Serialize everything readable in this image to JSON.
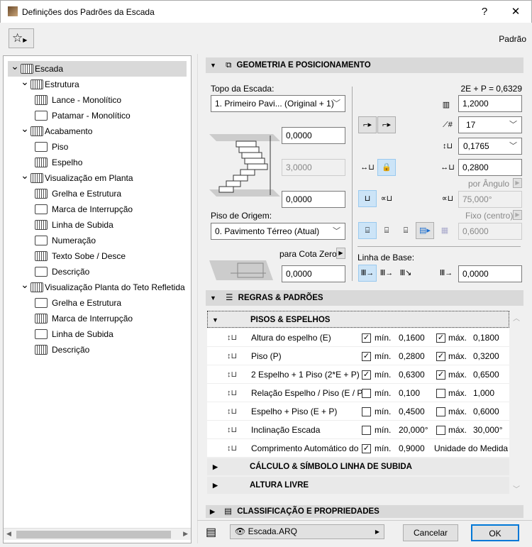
{
  "window": {
    "title": "Definições dos Padrões da Escada",
    "help": "?",
    "close": "✕"
  },
  "toolbar": {
    "favorites_icon": "star-icon",
    "preset": "Padrão"
  },
  "tree": [
    {
      "label": "Escada",
      "level": 0,
      "icon": "stair-icon",
      "expanded": true,
      "selected": true
    },
    {
      "label": "Estrutura",
      "level": 1,
      "icon": "structure-icon",
      "expanded": true
    },
    {
      "label": "Lance - Monolítico",
      "level": 2,
      "icon": "flight-icon"
    },
    {
      "label": "Patamar - Monolítico",
      "level": 2,
      "icon": "landing-icon"
    },
    {
      "label": "Acabamento",
      "level": 1,
      "icon": "finish-icon",
      "expanded": true
    },
    {
      "label": "Piso",
      "level": 2,
      "icon": "tread-icon"
    },
    {
      "label": "Espelho",
      "level": 2,
      "icon": "riser-icon"
    },
    {
      "label": "Visualização em Planta",
      "level": 1,
      "icon": "floor-plan-icon",
      "expanded": true
    },
    {
      "label": "Grelha e Estrutura",
      "level": 2,
      "icon": "grid-icon"
    },
    {
      "label": "Marca de Interrupção",
      "level": 2,
      "icon": "break-mark-icon"
    },
    {
      "label": "Linha de Subida",
      "level": 2,
      "icon": "walking-line-icon"
    },
    {
      "label": "Numeração",
      "level": 2,
      "icon": "numbering-icon"
    },
    {
      "label": "Texto Sobe / Desce",
      "level": 2,
      "icon": "text-icon"
    },
    {
      "label": "Descrição",
      "level": 2,
      "icon": "text-icon"
    },
    {
      "label": "Visualização Planta do Teto Refletida",
      "level": 1,
      "icon": "rcp-icon",
      "expanded": true
    },
    {
      "label": "Grelha e Estrutura",
      "level": 2,
      "icon": "grid-icon"
    },
    {
      "label": "Marca de Interrupção",
      "level": 2,
      "icon": "break-mark-icon"
    },
    {
      "label": "Linha de Subida",
      "level": 2,
      "icon": "walking-line-icon"
    },
    {
      "label": "Descrição",
      "level": 2,
      "icon": "text-icon"
    }
  ],
  "geometry": {
    "header": "GEOMETRIA E POSICIONAMENTO",
    "top_label": "Topo da Escada:",
    "top_value": "1. Primeiro Pavi... (Original + 1)",
    "top_offset": "0,0000",
    "height": "3,0000",
    "bottom_offset": "0,0000",
    "origin_label": "Piso de Origem:",
    "origin_value": "0. Pavimento Térreo (Atual)",
    "zero_label": "para Cota Zero",
    "zero_value": "0,0000",
    "formula": "2E + P = 0,6329",
    "width": "1,2000",
    "riser_count": "17",
    "riser_height": "0,1765",
    "tread_depth": "0,2800",
    "angle_mode": "por Ângulo",
    "angle": "75,000°",
    "fixed_mode": "Fixo (centro)",
    "offset": "0,6000",
    "baseline_label": "Linha de Base:",
    "baseline_offset": "0,0000"
  },
  "rules": {
    "header": "REGRAS & PADRÕES",
    "sub_open": "PISOS & ESPELHOS",
    "min_label": "mín.",
    "max_label": "máx.",
    "rows": [
      {
        "label": "Altura do espelho (E)",
        "min_on": true,
        "min": "0,1600",
        "max_on": true,
        "max": "0,1800"
      },
      {
        "label": "Piso (P)",
        "min_on": true,
        "min": "0,2800",
        "max_on": true,
        "max": "0,3200"
      },
      {
        "label": "2 Espelho + 1 Piso (2*E + P)",
        "min_on": true,
        "min": "0,6300",
        "max_on": true,
        "max": "0,6500"
      },
      {
        "label": "Relação Espelho / Piso (E / P)",
        "min_on": false,
        "min": "0,100",
        "max_on": false,
        "max": "1,000"
      },
      {
        "label": "Espelho + Piso (E + P)",
        "min_on": false,
        "min": "0,4500",
        "max_on": false,
        "max": "0,6000"
      },
      {
        "label": "Inclinação Escada",
        "min_on": false,
        "min": "20,000°",
        "max_on": false,
        "max": "30,000°"
      },
      {
        "label": "Comprimento Automático do",
        "min_on": true,
        "min": "0,9000",
        "max_text": "Unidade do Medida"
      }
    ],
    "sub_calc": "CÁLCULO & SÍMBOLO LINHA DE SUBIDA",
    "sub_height": "ALTURA LIVRE"
  },
  "classification": {
    "header": "CLASSIFICAÇÃO E PROPRIEDADES"
  },
  "footer": {
    "layer": "Escada.ARQ",
    "cancel": "Cancelar",
    "ok": "OK"
  }
}
